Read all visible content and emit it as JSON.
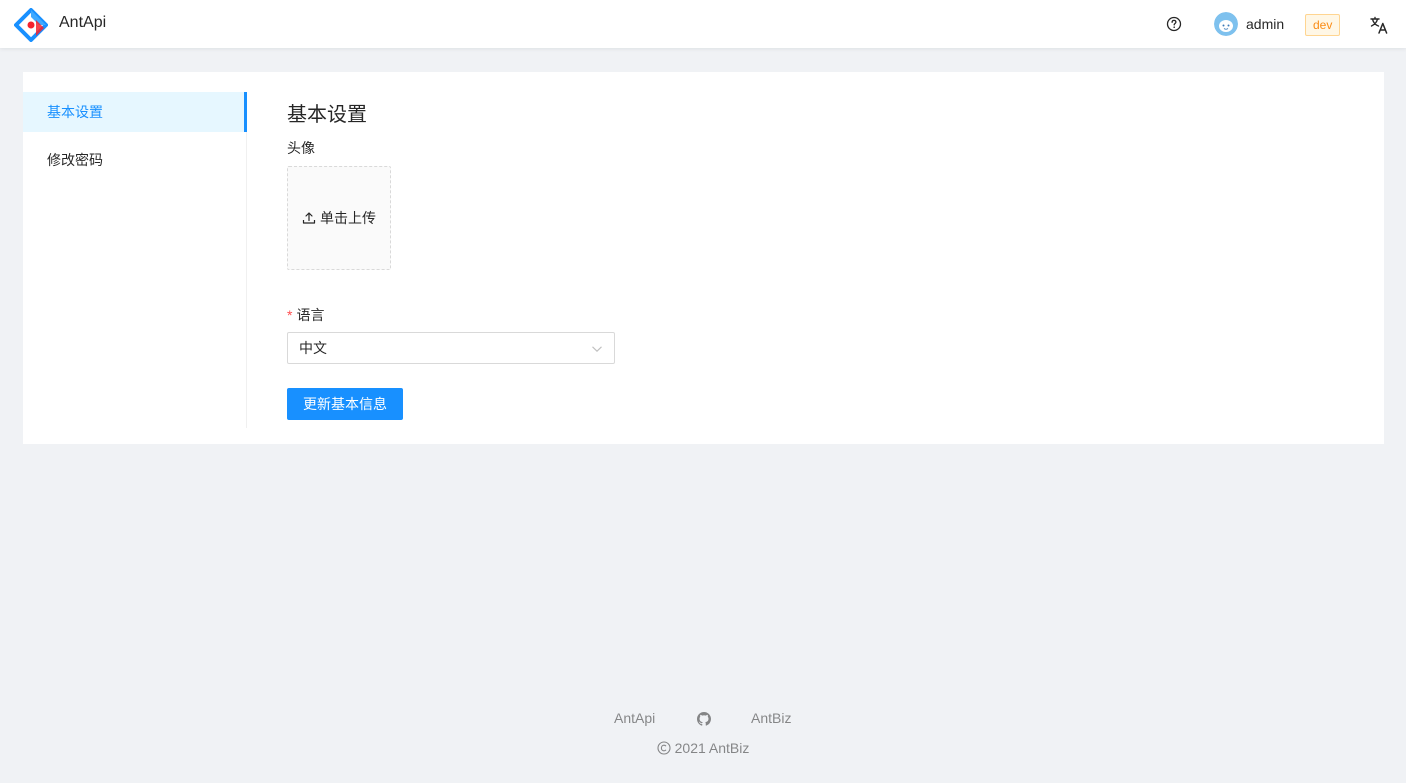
{
  "header": {
    "app_title": "AntApi",
    "username": "admin",
    "env_tag": "dev",
    "icons": [
      "logo-icon",
      "help-icon",
      "avatar",
      "translate-icon"
    ]
  },
  "sidebar": {
    "items": [
      {
        "label": "基本设置",
        "active": true
      },
      {
        "label": "修改密码",
        "active": false
      }
    ]
  },
  "main": {
    "title": "基本设置",
    "avatar_label": "头像",
    "upload_label": "单击上传",
    "language_label": "语言",
    "language_required_mark": "*",
    "language_value": "中文",
    "submit_label": "更新基本信息"
  },
  "footer": {
    "links": [
      "AntApi",
      "AntBiz"
    ],
    "copyright": "2021 AntBiz"
  },
  "colors": {
    "primary": "#1890ff",
    "tag_text": "#fa8c16",
    "tag_border": "#ffd591",
    "tag_bg": "#fff7e6",
    "required": "#ff4d4f",
    "page_bg": "#f0f2f5"
  }
}
